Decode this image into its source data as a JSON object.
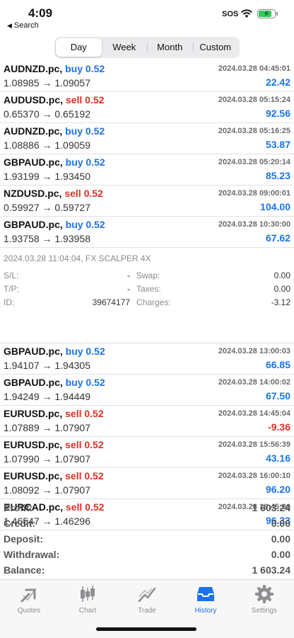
{
  "status_bar": {
    "time": "4:09",
    "back_label": "Search",
    "sos": "SOS"
  },
  "segments": [
    "Day",
    "Week",
    "Month",
    "Custom"
  ],
  "selected_segment": "Day",
  "deals": [
    {
      "symbol": "AUDNZD.pc,",
      "side": "buy 0.52",
      "time": "2024.03.28 04:45:01",
      "prices": "1.08985 → 1.09057",
      "profit": "22.42",
      "profit_color": "#1a73e8"
    },
    {
      "symbol": "AUDUSD.pc,",
      "side": "sell 0.52",
      "time": "2024.03.28 05:15:24",
      "prices": "0.65370 → 0.65192",
      "profit": "92.56",
      "profit_color": "#1a73e8"
    },
    {
      "symbol": "AUDNZD.pc,",
      "side": "buy 0.52",
      "time": "2024.03.28 05:16:25",
      "prices": "1.08886 → 1.09059",
      "profit": "53.87",
      "profit_color": "#1a73e8"
    },
    {
      "symbol": "GBPAUD.pc,",
      "side": "buy 0.52",
      "time": "2024.03.28 05:20:14",
      "prices": "1.93199 → 1.93450",
      "profit": "85.23",
      "profit_color": "#1a73e8"
    },
    {
      "symbol": "NZDUSD.pc,",
      "side": "sell 0.52",
      "time": "2024.03.28 09:00:01",
      "prices": "0.59927 → 0.59727",
      "profit": "104.00",
      "profit_color": "#1a73e8"
    },
    {
      "symbol": "GBPAUD.pc,",
      "side": "buy 0.52",
      "time": "2024.03.28 10:30:00",
      "prices": "1.93758 → 1.93958",
      "profit": "67.62",
      "profit_color": "#1a73e8"
    }
  ],
  "detail": {
    "header": "2024.03.28 11:04:04, FX SCALPER 4X",
    "sl_label": "S/L:",
    "sl_value": "-",
    "tp_label": "T/P:",
    "tp_value": "-",
    "id_label": "ID:",
    "id_value": "39674177",
    "swap_label": "Swap:",
    "swap_value": "0.00",
    "taxes_label": "Taxes:",
    "taxes_value": "0.00",
    "charges_label": "Charges:",
    "charges_value": "-3.12"
  },
  "deals2": [
    {
      "symbol": "GBPAUD.pc,",
      "side": "buy 0.52",
      "time": "2024.03.28 13:00:03",
      "prices": "1.94107 → 1.94305",
      "profit": "66.85",
      "profit_color": "#1a73e8"
    },
    {
      "symbol": "GBPAUD.pc,",
      "side": "buy 0.52",
      "time": "2024.03.28 14:00:02",
      "prices": "1.94249 → 1.94449",
      "profit": "67.50",
      "profit_color": "#1a73e8"
    },
    {
      "symbol": "EURUSD.pc,",
      "side": "sell 0.52",
      "time": "2024.03.28 14:45:04",
      "prices": "1.07889 → 1.07907",
      "profit": "-9.36",
      "profit_color": "#d93025"
    },
    {
      "symbol": "EURUSD.pc,",
      "side": "sell 0.52",
      "time": "2024.03.28 15:56:39",
      "prices": "1.07990 → 1.07907",
      "profit": "43.16",
      "profit_color": "#1a73e8"
    },
    {
      "symbol": "EURUSD.pc,",
      "side": "sell 0.52",
      "time": "2024.03.28 16:00:10",
      "prices": "1.08092 → 1.07907",
      "profit": "96.20",
      "profit_color": "#1a73e8"
    },
    {
      "symbol": "EURCAD.pc,",
      "side": "sell 0.52",
      "time": "2024.03.28 16:45:00",
      "prices": "1.46547 → 1.46296",
      "profit": "96.33",
      "profit_color": "#1a73e8"
    }
  ],
  "summary": [
    {
      "label": "Profit:",
      "value": "1 603.24"
    },
    {
      "label": "Credit:",
      "value": "0.00"
    },
    {
      "label": "Deposit:",
      "value": "0.00"
    },
    {
      "label": "Withdrawal:",
      "value": "0.00"
    },
    {
      "label": "Balance:",
      "value": "1 603.24"
    }
  ],
  "tabs": [
    {
      "label": "Quotes",
      "icon": "quotes-icon",
      "active": false
    },
    {
      "label": "Chart",
      "icon": "candlestick-chart-icon",
      "active": false
    },
    {
      "label": "Trade",
      "icon": "trade-icon",
      "active": false
    },
    {
      "label": "History",
      "icon": "inbox-tray-icon",
      "active": true
    },
    {
      "label": "Settings",
      "icon": "gear-icon",
      "active": false
    }
  ],
  "colors": {
    "buy": "#1a73e8",
    "sell": "#d93025",
    "active_tab": "#1a73e8",
    "inactive_tab": "#8e8e93"
  }
}
